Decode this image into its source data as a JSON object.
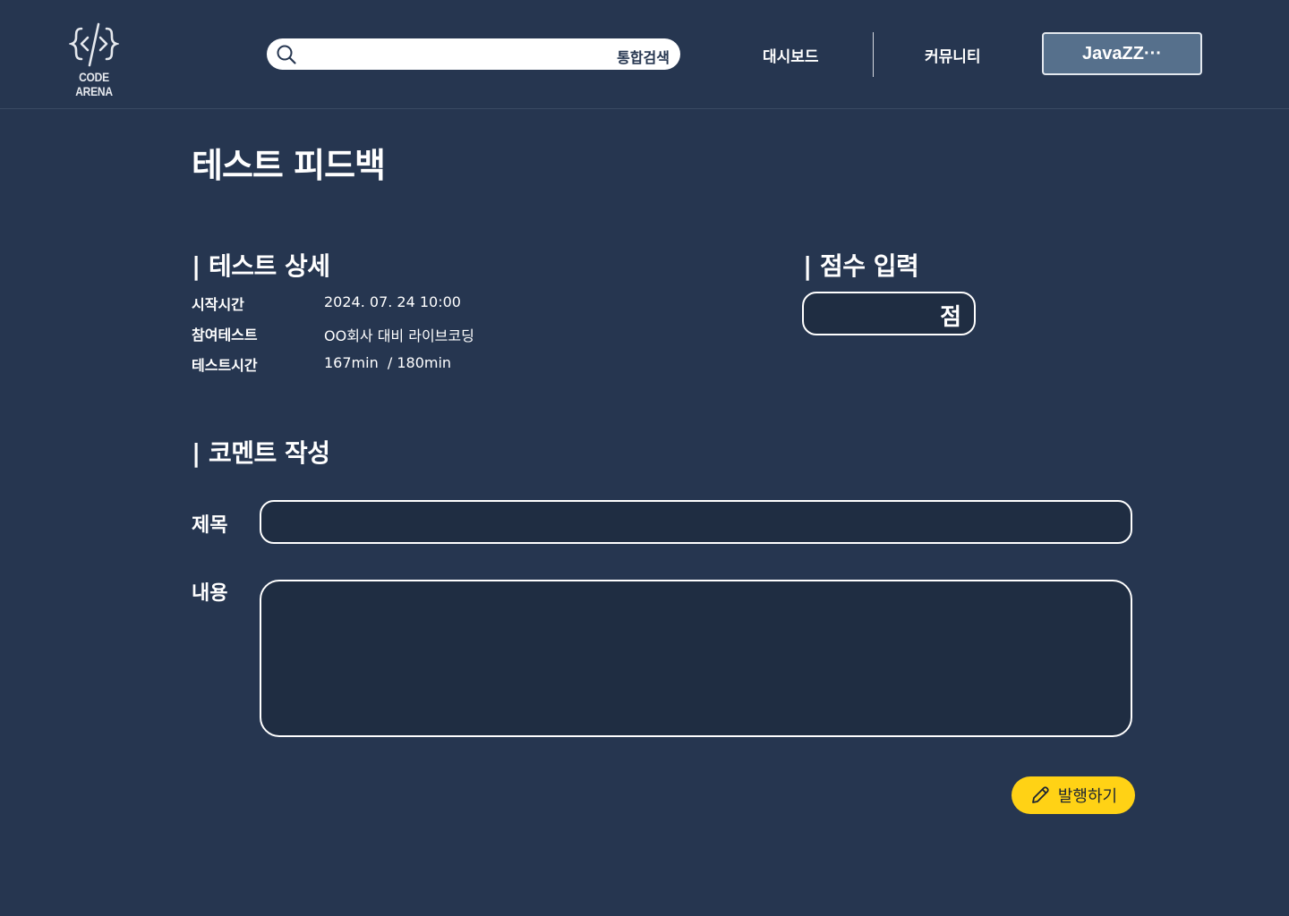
{
  "header": {
    "logo_text": "CODE ARENA",
    "search_label": "통합검색",
    "nav": [
      "대시보드",
      "커뮤니티"
    ],
    "user_name": "JavaZZ···"
  },
  "page": {
    "title": "테스트 피드백"
  },
  "test_detail": {
    "section_title": "| 테스트 상세",
    "rows": [
      {
        "label": "시작시간",
        "value": "2024. 07. 24 10:00"
      },
      {
        "label": "참여테스트",
        "value": "OO회사 대비 라이브코딩"
      },
      {
        "label": "테스트시간",
        "value": "167min  / 180min"
      }
    ]
  },
  "score": {
    "section_title": "| 점수 입력",
    "unit": "점"
  },
  "comment": {
    "section_title": "| 코멘트 작성",
    "title_label": "제목",
    "content_label": "내용",
    "submit_label": "발행하기"
  },
  "colors": {
    "background": "#263650",
    "input_background": "#1f2d42",
    "user_button": "#56708c",
    "accent": "#ffd215"
  }
}
